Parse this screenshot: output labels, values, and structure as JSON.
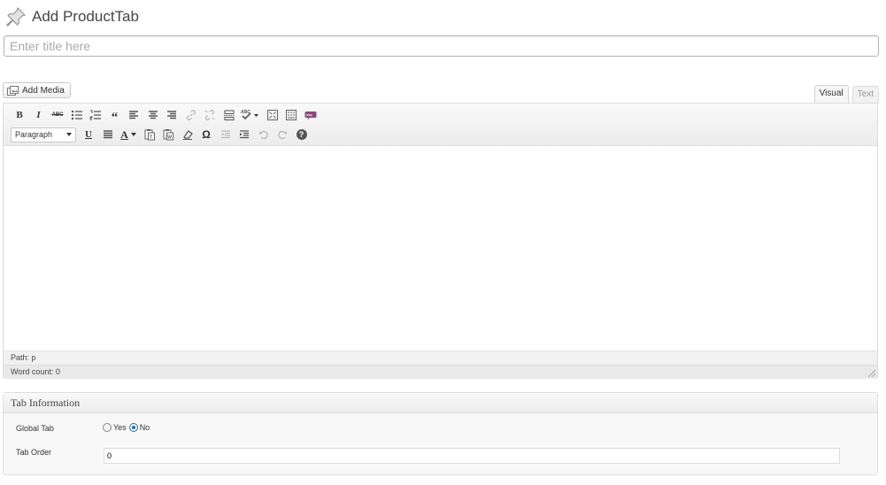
{
  "header": {
    "title": "Add ProductTab",
    "icon": "pushpin-icon"
  },
  "title_field": {
    "placeholder": "Enter title here",
    "value": ""
  },
  "media": {
    "label": "Add Media",
    "icon": "media-icon"
  },
  "mode_tabs": [
    {
      "label": "Visual",
      "active": true
    },
    {
      "label": "Text",
      "active": false
    }
  ],
  "toolbar": {
    "row1": [
      "bold",
      "italic",
      "strikethrough",
      "bullet-list",
      "numbered-list",
      "blockquote",
      "align-left",
      "align-center",
      "align-right",
      "insert-link",
      "remove-link",
      "insert-more",
      "spellcheck",
      "fullscreen",
      "toolbar-toggle",
      "woocommerce-shortcode"
    ],
    "format_select": "Paragraph",
    "row2": [
      "underline",
      "justify",
      "text-color",
      "paste-text",
      "paste-word",
      "clear-formatting",
      "special-character",
      "outdent",
      "indent",
      "undo",
      "redo",
      "help"
    ],
    "labels": {
      "bold": "B",
      "italic": "I",
      "strike": "ABC",
      "quote": "“",
      "underline": "U",
      "textcolor": "A",
      "omega": "Ω",
      "help": "?"
    }
  },
  "status": {
    "path": "Path: p",
    "word_count": "Word count: 0"
  },
  "metabox": {
    "title": "Tab Information",
    "global_tab": {
      "label": "Global Tab",
      "options": [
        "Yes",
        "No"
      ],
      "selected": "No"
    },
    "tab_order": {
      "label": "Tab Order",
      "value": "0"
    }
  }
}
